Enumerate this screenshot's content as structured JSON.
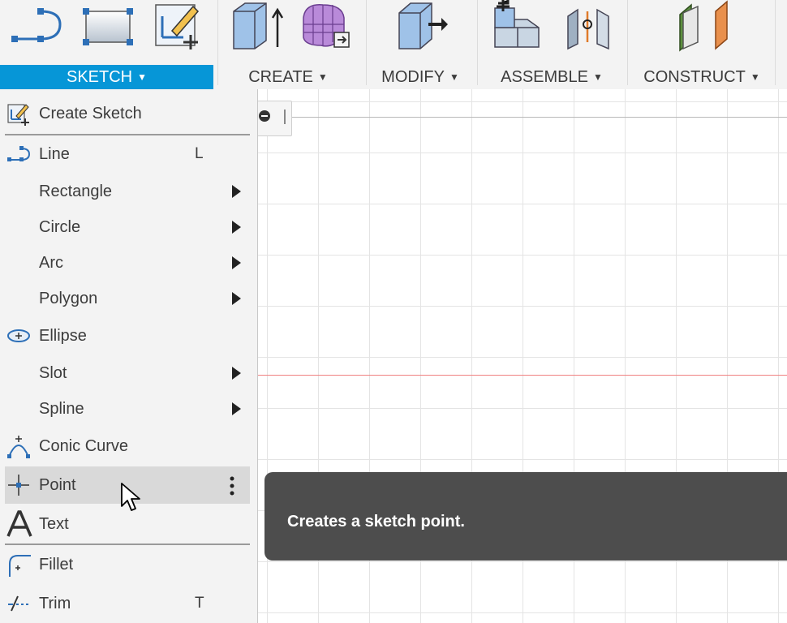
{
  "toolbar": {
    "groups": [
      {
        "label": "SKETCH",
        "active": true
      },
      {
        "label": "CREATE",
        "active": false
      },
      {
        "label": "MODIFY",
        "active": false
      },
      {
        "label": "ASSEMBLE",
        "active": false
      },
      {
        "label": "CONSTRUCT",
        "active": false
      }
    ]
  },
  "sketch_menu": {
    "items": [
      {
        "label": "Create Sketch",
        "icon": "create-sketch-icon"
      },
      {
        "label": "Line",
        "shortcut": "L",
        "icon": "line-icon"
      },
      {
        "label": "Rectangle",
        "submenu": true
      },
      {
        "label": "Circle",
        "submenu": true
      },
      {
        "label": "Arc",
        "submenu": true
      },
      {
        "label": "Polygon",
        "submenu": true
      },
      {
        "label": "Ellipse",
        "icon": "ellipse-icon"
      },
      {
        "label": "Slot",
        "submenu": true
      },
      {
        "label": "Spline",
        "submenu": true
      },
      {
        "label": "Conic Curve",
        "icon": "conic-curve-icon"
      },
      {
        "label": "Point",
        "icon": "point-icon",
        "highlighted": true
      },
      {
        "label": "Text",
        "icon": "text-icon"
      },
      {
        "label": "Fillet",
        "icon": "fillet-icon"
      },
      {
        "label": "Trim",
        "shortcut": "T",
        "icon": "trim-icon"
      }
    ]
  },
  "tooltip": {
    "text": "Creates a sketch point."
  },
  "colors": {
    "accent": "#0696d7",
    "menu_bg": "#f3f3f3",
    "highlight": "#d9d9d9",
    "tooltip_bg": "#4d4d4d",
    "axis_red": "#f08080"
  }
}
